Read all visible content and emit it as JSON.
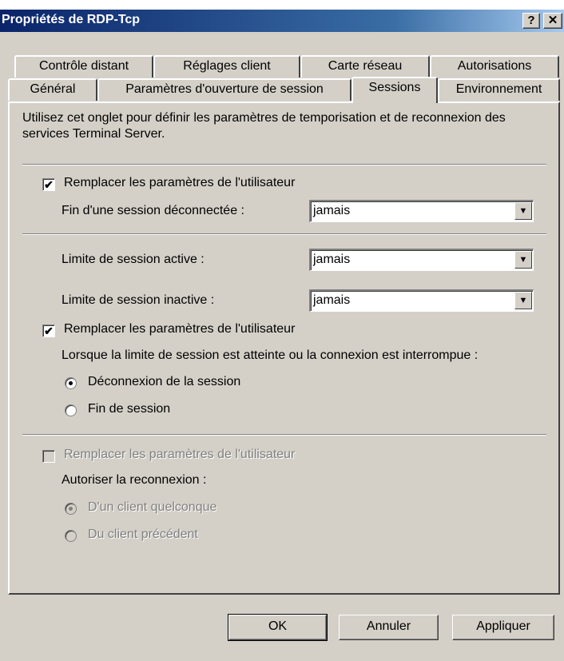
{
  "window": {
    "title": "Propriétés de RDP-Tcp",
    "help_label": "?",
    "close_label": "✕"
  },
  "tabs_back": [
    "Contrôle distant",
    "Réglages client",
    "Carte réseau",
    "Autorisations"
  ],
  "tabs_front": [
    "Général",
    "Paramètres d'ouverture de session",
    "Sessions",
    "Environnement"
  ],
  "active_tab": "Sessions",
  "panel": {
    "description": "Utilisez cet onglet pour définir les paramètres de temporisation et de reconnexion des services Terminal Server.",
    "override1": {
      "label": "Remplacer les paramètres de l'utilisateur",
      "checked": true,
      "mark": "✔"
    },
    "disconnected_label": "Fin d'une session déconnectée :",
    "disconnected_value": "jamais",
    "active_limit_label": "Limite de session active :",
    "active_limit_value": "jamais",
    "idle_limit_label": "Limite de session inactive :",
    "idle_limit_value": "jamais",
    "override2": {
      "label": "Remplacer les paramètres de l'utilisateur",
      "checked": true,
      "mark": "✔"
    },
    "limit_reached_label": "Lorsque la limite de session est atteinte ou la connexion est interrompue :",
    "radio_disconnect": {
      "label": "Déconnexion de la session",
      "checked": true
    },
    "radio_end": {
      "label": "Fin de session",
      "checked": false
    },
    "override3": {
      "label": "Remplacer les paramètres de l'utilisateur",
      "checked": false,
      "enabled": false
    },
    "reconnect_label": "Autoriser la reconnexion :",
    "radio_any_client": {
      "label": "D'un client quelconque",
      "checked": true,
      "enabled": false
    },
    "radio_prev_client": {
      "label": "Du client précédent",
      "checked": false,
      "enabled": false
    }
  },
  "buttons": {
    "ok": "OK",
    "cancel": "Annuler",
    "apply": "Appliquer"
  },
  "combo_arrow": "▼"
}
